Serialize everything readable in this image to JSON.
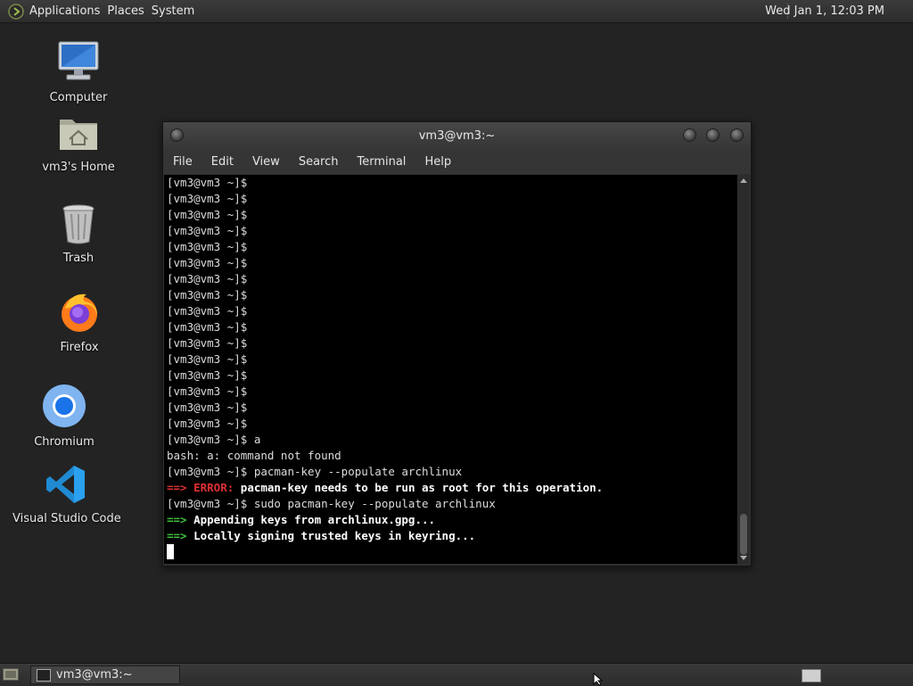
{
  "top_panel": {
    "menus": [
      "Applications",
      "Places",
      "System"
    ],
    "clock": "Wed Jan  1, 12:03 PM"
  },
  "desktop_icons": [
    {
      "label": "Computer",
      "icon": "computer-icon"
    },
    {
      "label": "vm3's Home",
      "icon": "home-folder-icon"
    },
    {
      "label": "Trash",
      "icon": "trash-icon"
    },
    {
      "label": "Firefox",
      "icon": "firefox-icon"
    },
    {
      "label": "Chromium",
      "icon": "chromium-icon"
    },
    {
      "label": "Visual Studio Code",
      "icon": "vscode-icon"
    }
  ],
  "terminal": {
    "title": "vm3@vm3:~",
    "menu": [
      "File",
      "Edit",
      "View",
      "Search",
      "Terminal",
      "Help"
    ],
    "prompt": "[vm3@vm3 ~]$",
    "empty_prompt_count": 16,
    "lines": [
      {
        "kind": "prompt",
        "text": "[vm3@vm3 ~]$ a"
      },
      {
        "kind": "plain",
        "text": "bash: a: command not found"
      },
      {
        "kind": "prompt",
        "text": "[vm3@vm3 ~]$ pacman-key --populate archlinux"
      },
      {
        "kind": "error",
        "arrow": "==>",
        "label": "ERROR:",
        "text": "pacman-key needs to be run as root for this operation."
      },
      {
        "kind": "prompt",
        "text": "[vm3@vm3 ~]$ sudo pacman-key --populate archlinux"
      },
      {
        "kind": "ok",
        "arrow": "==>",
        "text": "Appending keys from archlinux.gpg..."
      },
      {
        "kind": "ok",
        "arrow": "==>",
        "text": "Locally signing trusted keys in keyring..."
      }
    ]
  },
  "taskbar": {
    "task_label": "vm3@vm3:~"
  },
  "colors": {
    "error": "#e03030",
    "ok": "#3fc03f",
    "desktop": "#232323"
  }
}
